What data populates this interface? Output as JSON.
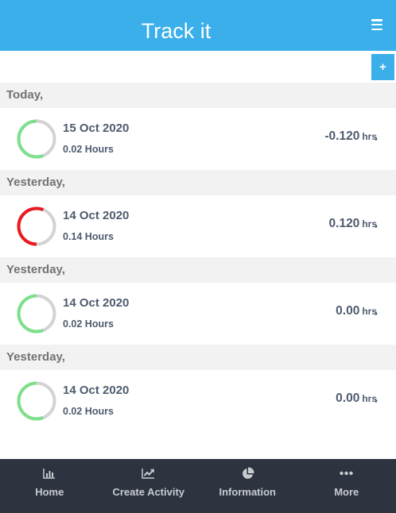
{
  "header": {
    "title": "Track it",
    "menu_icon": "hamburger-icon"
  },
  "toolbar": {
    "add_label": "+"
  },
  "colors": {
    "accent": "#3aafea",
    "positive": "#7ee08c",
    "negative": "#e81b20",
    "track": "#d3d3d3"
  },
  "entries": [
    {
      "day": "Today,",
      "date": "15 Oct 2020",
      "hours": "0.02 Hours",
      "value": "-0.120",
      "unit": "hrs",
      "progress": 0.56,
      "status": "positive"
    },
    {
      "day": "Yesterday,",
      "date": "14 Oct 2020",
      "hours": "0.14 Hours",
      "value": "0.120",
      "unit": "hrs",
      "progress": 0.56,
      "status": "negative"
    },
    {
      "day": "Yesterday,",
      "date": "14 Oct 2020",
      "hours": "0.02 Hours",
      "value": "0.00",
      "unit": "hrs",
      "progress": 0.56,
      "status": "positive"
    },
    {
      "day": "Yesterday,",
      "date": "14 Oct 2020",
      "hours": "0.02 Hours",
      "value": "0.00",
      "unit": "hrs",
      "progress": 0.56,
      "status": "positive"
    }
  ],
  "tabbar": {
    "tabs": [
      {
        "label": "Home",
        "icon": "bar-chart-icon"
      },
      {
        "label": "Create Activity",
        "icon": "line-chart-icon"
      },
      {
        "label": "Information",
        "icon": "pie-chart-icon"
      },
      {
        "label": "More",
        "icon": "more-dots-icon"
      }
    ]
  }
}
